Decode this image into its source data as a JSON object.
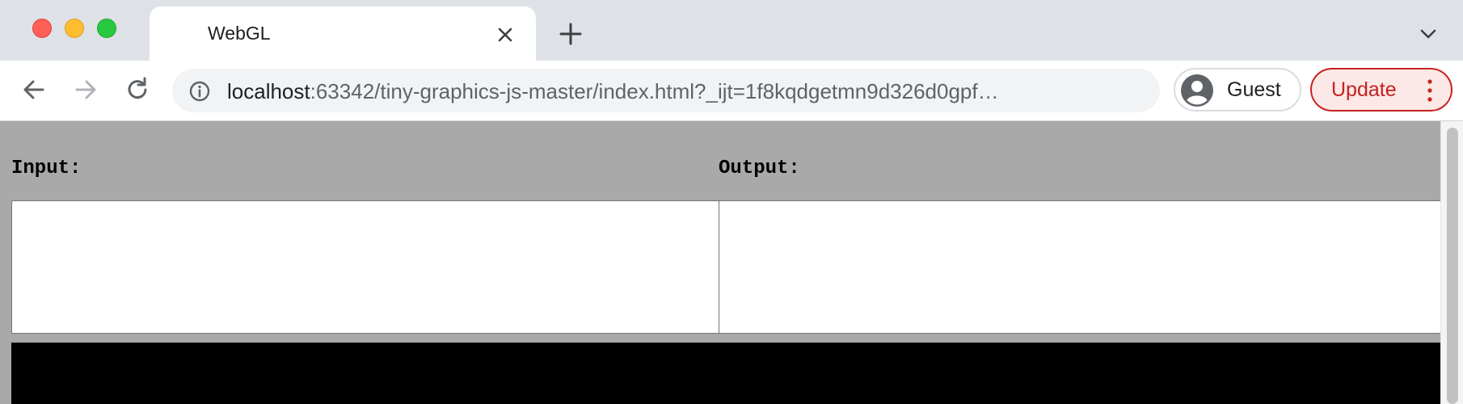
{
  "window": {
    "tab": {
      "title": "WebGL"
    }
  },
  "toolbar": {
    "url_host": "localhost",
    "url_rest": ":63342/tiny-graphics-js-master/index.html?_ijt=1f8kqdgetmn9d326d0gpf…",
    "profile_label": "Guest",
    "update_label": "Update"
  },
  "page": {
    "input_label": "Input:",
    "output_label": "Output:",
    "input_value": "",
    "output_value": ""
  },
  "colors": {
    "page_bg": "#a9a9a9",
    "canvas_bg": "#000000",
    "update_accent": "#c5221f"
  },
  "icons": [
    "close-icon",
    "plus-icon",
    "chevron-down-icon",
    "back-arrow-icon",
    "forward-arrow-icon",
    "reload-icon",
    "info-icon",
    "avatar-icon",
    "more-vert-icon"
  ]
}
